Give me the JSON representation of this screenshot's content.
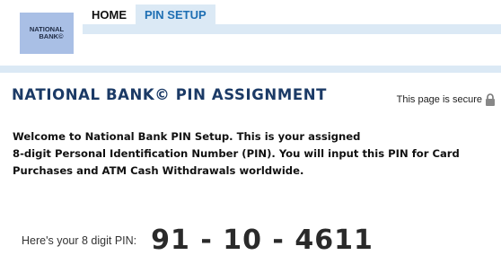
{
  "logo": {
    "line1": "NATIONAL",
    "line2": "BANK©"
  },
  "nav": {
    "home_label": "HOME",
    "pin_setup_label": "PIN SETUP"
  },
  "page": {
    "title": "NATIONAL BANK© PIN ASSIGNMENT",
    "secure_text": "This page is secure"
  },
  "welcome": {
    "line1": "Welcome to National Bank PIN Setup. This is your assigned",
    "line2": "8-digit Personal Identification Number (PIN). You will input this PIN for Card",
    "line3": "Purchases and ATM Cash Withdrawals worldwide."
  },
  "pin": {
    "label": "Here's your 8 digit PIN:",
    "value": "91 - 10 - 4611"
  },
  "colors": {
    "accent_bar": "#dbe9f5",
    "logo_bg": "#a9bfe5",
    "title": "#1b3a66",
    "active_tab": "#1e6fb3"
  }
}
